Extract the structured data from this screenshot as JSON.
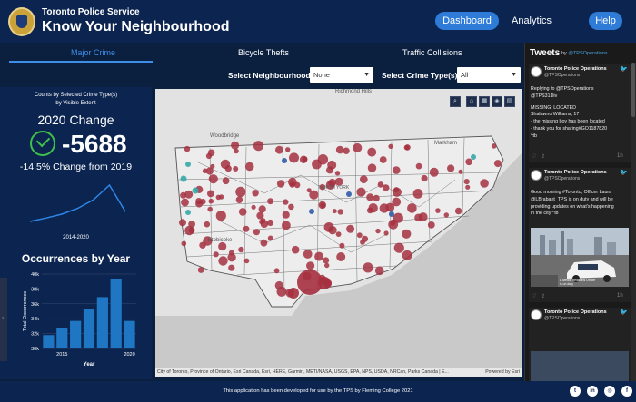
{
  "header": {
    "org": "Toronto Police Service",
    "title": "Know Your Neighbourhood",
    "nav": {
      "dashboard": "Dashboard",
      "analytics": "Analytics",
      "help": "Help"
    }
  },
  "tabs": {
    "major": "Major Crime",
    "bicycle": "Bicycle Thefts",
    "traffic": "Traffic Collisions"
  },
  "filters": {
    "neighbourhood_label": "Select Neighbourhood",
    "neighbourhood_value": "None",
    "crime_type_label": "Select Crime Type(s):",
    "crime_type_value": "All"
  },
  "summary": {
    "caption_line1": "Counts by Selected Crime Type(s)",
    "caption_line2": "by Visible Extent",
    "change_title": "2020 Change",
    "change_value": "-5688",
    "pct_text": "-14.5% Change from 2019",
    "trend_range": "2014-2020",
    "trend_values": [
      30.5,
      31.2,
      32.0,
      33.2,
      35.0,
      38.0,
      32.5
    ]
  },
  "occurrences_title": "Occurrences by Year",
  "chart_data": {
    "type": "bar",
    "title": "Occurrences by Year",
    "xlabel": "Year",
    "ylabel": "Total Occurrences",
    "categories": [
      "2014",
      "2015",
      "2016",
      "2017",
      "2018",
      "2019",
      "2020"
    ],
    "values": [
      31.8,
      32.7,
      33.7,
      35.3,
      36.9,
      39.3,
      33.7
    ],
    "x_tick_labels": [
      "2015",
      "2020"
    ],
    "y_tick_labels": [
      "30k",
      "32k",
      "34k",
      "36k",
      "38k",
      "40k"
    ],
    "ylim": [
      30,
      40
    ],
    "color": "#1f77c4"
  },
  "map": {
    "labels": {
      "richmond_hill": "Richmond Hills",
      "markham": "Markham",
      "woodbridge": "Woodbridge",
      "north_york": "NORTH YORK",
      "etobicoke": "Etobicoke"
    },
    "attribution": "City of Toronto, Province of Ontario, Esri Canada, Esri, HERE, Garmin, METI/NASA, USGS, EPA, NPS, USDA, NRCan, Parks Canada | E...",
    "powered": "Powered by Esri",
    "colors": {
      "crime": "#a5303f",
      "teal": "#36a8a8",
      "blue": "#2f5ca8",
      "land": "#f0f0f0",
      "water": "#c8c8c8"
    }
  },
  "tweets": {
    "title": "Tweets",
    "by_prefix": "by",
    "by_handle": "@TPSOperations",
    "items": [
      {
        "name": "Toronto Police Operations",
        "handle": "@TPSOperations",
        "lines": [
          "Replying to @TPSOperations",
          "@TPS31Div",
          "",
          "MISSING: LOCATED",
          "Shalawno Williams, 17",
          "- the missing boy has been located",
          "- thank you for sharing#GO1187820",
          "^tb"
        ],
        "time": "1h"
      },
      {
        "name": "Toronto Police Operations",
        "handle": "@TPSOperations",
        "lines": [
          "Good morning #Toronto, Officer Laura",
          "@LBrabant_TPS is on duty and will be",
          "providing updates on what's happening",
          "in the city ^lb"
        ],
        "image_caption": "A Media Relations Officer is on duty",
        "time": "1h"
      },
      {
        "name": "Toronto Police Operations",
        "handle": "@TPSOperations"
      }
    ]
  },
  "footer": {
    "text": "This application has been developed for use by the TPS by Fleming College 2021"
  }
}
